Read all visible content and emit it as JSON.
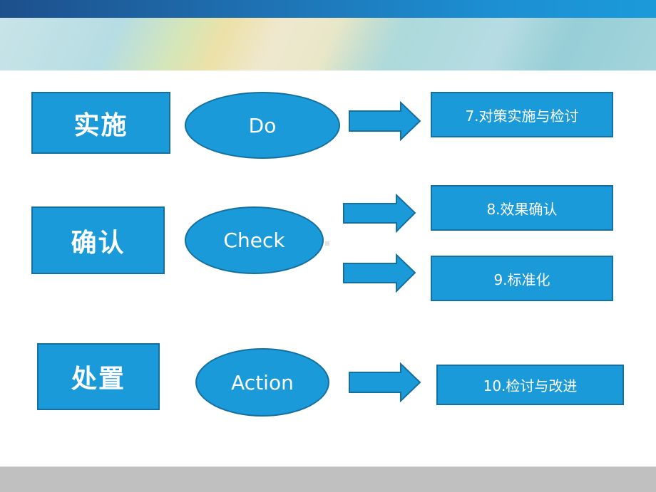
{
  "header": {
    "theme": "gradient banner"
  },
  "colors": {
    "shape_fill": "#1b9ad9",
    "shape_border": "#156fa0",
    "text": "#ffffff",
    "footer": "#c0c0c0"
  },
  "rows": [
    {
      "phase_cn": "实施",
      "phase_en": "Do",
      "steps": [
        "7.对策实施与检讨"
      ]
    },
    {
      "phase_cn": "确认",
      "phase_en": "Check",
      "steps": [
        "8.效果确认",
        "9.标准化"
      ]
    },
    {
      "phase_cn": "处置",
      "phase_en": "Action",
      "steps": [
        "10.检讨与改进"
      ]
    }
  ]
}
